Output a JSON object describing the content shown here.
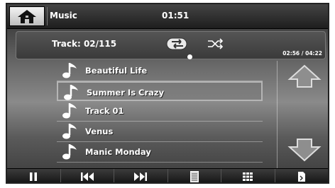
{
  "status": {
    "app_title": "Music",
    "clock": "01:51"
  },
  "player": {
    "track_label": "Track: 02/115",
    "time_label": "02:56 / 04:22",
    "progress": 0.67
  },
  "playlist": {
    "songs": [
      "Beautiful Life",
      "Summer Is Crazy",
      "Track 01",
      "Venus",
      "Manic Monday"
    ],
    "selected_index": 1
  },
  "toolbar": {
    "icons": [
      "pause-icon",
      "previous-icon",
      "next-icon",
      "list-icon",
      "grid-icon",
      "file-icon"
    ]
  },
  "colors": {
    "text": "#ffffff",
    "panel": "#3a3a3a"
  }
}
